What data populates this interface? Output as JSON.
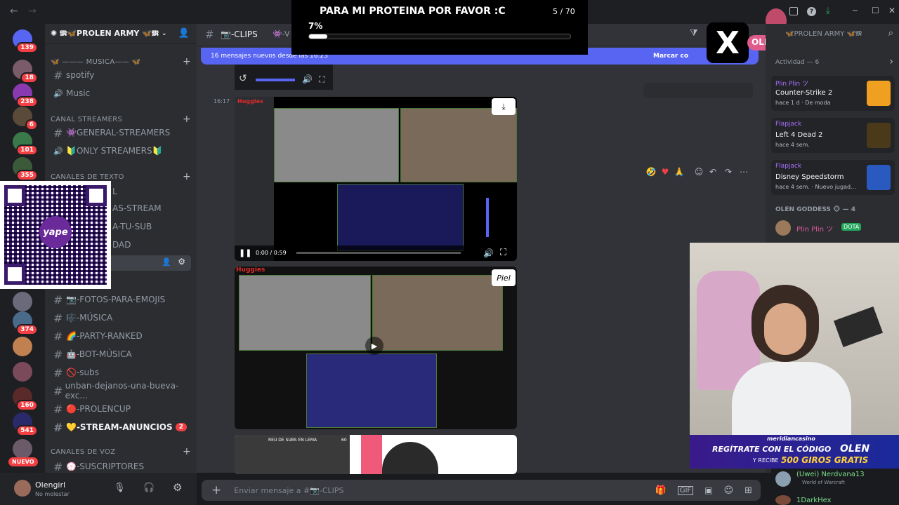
{
  "titlebar": {
    "back": "←",
    "forward": "→",
    "x_handle": "OLENGIRLM",
    "win_min": "─",
    "win_max": "☐",
    "win_close": "✕"
  },
  "stream_goal": {
    "text": "PARA MI PROTEINA POR FAVOR :C",
    "count": "5 / 70",
    "percent_label": "7%",
    "progress": 0.07
  },
  "servers": {
    "badges": [
      "139",
      "18",
      "238",
      "6",
      "101",
      "355",
      "374",
      "160",
      "541"
    ],
    "new_label": "NUEVO"
  },
  "guild": {
    "name": "𝕸🦋PROLEN ARMY 🦋𝕸",
    "emblem": "✺"
  },
  "channels": {
    "music_category": "🦋 ——— MUSICA—— 🦋",
    "music_items": [
      {
        "label": "spotify",
        "icon": "#"
      },
      {
        "label": "Music",
        "icon": "🔊"
      }
    ],
    "streamers_category": "CANAL STREAMERS",
    "streamers_items": [
      {
        "label": "👾GENERAL-STREAMERS",
        "icon": "#"
      },
      {
        "label": "🔰ONLY STREAMERS🔰",
        "icon": "🔊"
      }
    ],
    "text_category": "CANALES DE TEXTO",
    "text_partial": [
      "L",
      "AS-STREAM",
      "A-TU-SUB",
      "DAD"
    ],
    "text_items": [
      {
        "label": "📷-FOTOS-PARA-EMOJIS"
      },
      {
        "label": "🎼-MÚSICA"
      },
      {
        "label": "🌈-PARTY-RANKED"
      },
      {
        "label": "🤖-BOT-MÚSICA"
      },
      {
        "label": "🚫-subs"
      },
      {
        "label": "unban-dejanos-una-bueva-exc..."
      },
      {
        "label": "🔴-PROLENCUP"
      },
      {
        "label": "💛-STREAM-ANUNCIOS",
        "badge": "2"
      }
    ],
    "voice_category": "CANALES DE VOZ",
    "voice_items": [
      {
        "label": "💮-SUSCRIPTORES"
      }
    ]
  },
  "user": {
    "name": "Olengirl",
    "status": "No molestar"
  },
  "chat": {
    "channel_name": "📷-CLIPS",
    "tab_partial": "👾-V",
    "new_messages": "16 mensajes nuevos desde las 16:23",
    "mark_read": "Marcar co",
    "timestamp": "16:17",
    "video1": {
      "time": "0:00 / 0:59",
      "brand": "Huggies"
    },
    "video2": {
      "brand": "Huggies",
      "sponsor": "Piel"
    },
    "video3": {
      "header": "REU DE SUBS EN LEMA",
      "num": "60"
    },
    "composer_placeholder": "Enviar mensaje a #📷-CLIPS"
  },
  "members": {
    "server_name": "🦋PROLEN ARMY 🦋𝕸",
    "activity_header": "Actividad — 6",
    "activities": [
      {
        "name": "Plin Plin ツ",
        "game": "Counter-Strike 2",
        "time": "hace 1 d",
        "extra": "De moda"
      },
      {
        "name": "Flapjack",
        "game": "Left 4 Dead 2",
        "time": "hace 4 sem.",
        "extra": ""
      },
      {
        "name": "Flapjack",
        "game": "Disney Speedstorm",
        "time": "hace 4 sem.",
        "extra": "Nuevo jugad..."
      }
    ],
    "role_header": "OLEN GODDESS 🐵 — 4",
    "role_member": "Plin Plin ツ",
    "role_member_tag": "DOTA"
  },
  "overlay_promo": {
    "casino": "meridiancasino",
    "line1": "REGÍTRATE CON EL CÓDIGO",
    "code": "OLEN",
    "line2a": "Y RECIBE",
    "line2b": "500 GIROS GRATIS"
  },
  "chat_overlay": [
    {
      "name": "(Uwei) Nerdvana13",
      "sub": "World of Warcraft"
    },
    {
      "name": "1DarkHex",
      "sub": ""
    }
  ],
  "qr": {
    "label": "yape"
  },
  "colors": {
    "blurple": "#5865f2",
    "red": "#f23f43",
    "green": "#23a55a",
    "purple": "#a970ff"
  }
}
